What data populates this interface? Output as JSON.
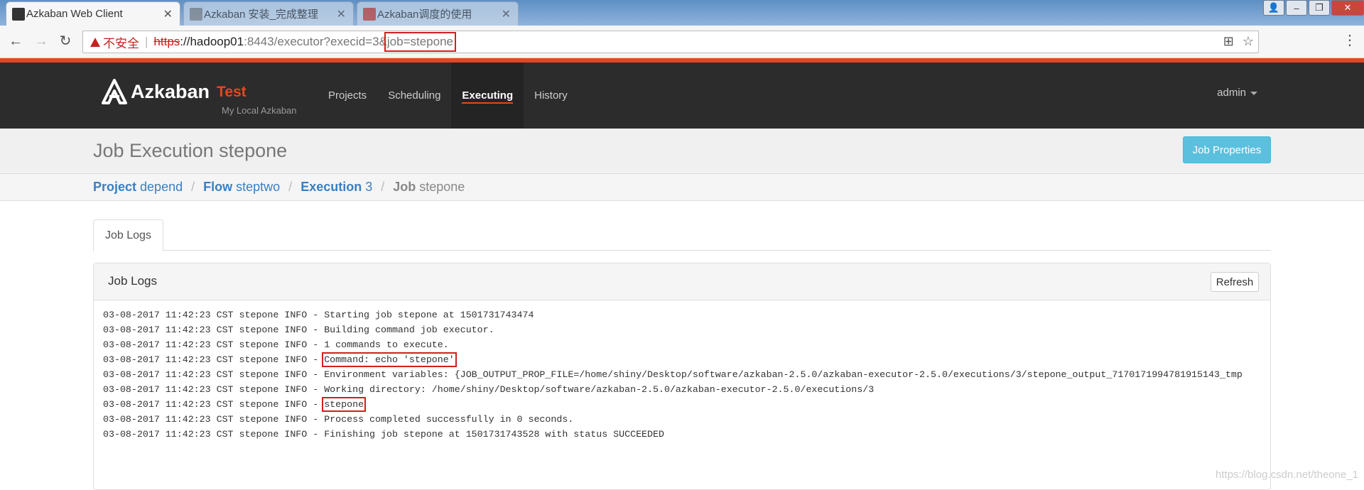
{
  "browser": {
    "tabs": [
      {
        "title": "Azkaban Web Client",
        "active": true
      },
      {
        "title": "Azkaban 安装_完成整理",
        "active": false
      },
      {
        "title": "Azkaban调度的使用",
        "active": false
      }
    ],
    "address": {
      "warning": "不安全",
      "scheme": "https",
      "host": "://hadoop01",
      "path": ":8443/executor?execid=3&",
      "highlight": "job=stepone"
    },
    "icons": [
      "back-icon",
      "forward-icon",
      "reload-icon",
      "translate-icon",
      "star-icon",
      "menu-icon"
    ]
  },
  "navbar": {
    "brand": "Azkaban",
    "env": "Test",
    "subtitle": "My Local Azkaban",
    "links": [
      "Projects",
      "Scheduling",
      "Executing",
      "History"
    ],
    "active_link": "Executing",
    "user": "admin"
  },
  "header": {
    "title": "Job Execution stepone",
    "job_properties_button": "Job Properties"
  },
  "breadcrumb": [
    {
      "key": "Project",
      "value": "depend"
    },
    {
      "key": "Flow",
      "value": "steptwo"
    },
    {
      "key": "Execution",
      "value": "3"
    },
    {
      "key": "Job",
      "value": "stepone"
    }
  ],
  "tabs": {
    "job_logs": "Job Logs"
  },
  "panel": {
    "title": "Job Logs",
    "refresh": "Refresh",
    "lines": [
      {
        "prefix": "03-08-2017 11:42:23 CST stepone INFO - ",
        "msg": "Starting job stepone at 1501731743474",
        "boxed": false
      },
      {
        "prefix": "03-08-2017 11:42:23 CST stepone INFO - ",
        "msg": "Building command job executor.",
        "boxed": false
      },
      {
        "prefix": "03-08-2017 11:42:23 CST stepone INFO - ",
        "msg": "1 commands to execute.",
        "boxed": false
      },
      {
        "prefix": "03-08-2017 11:42:23 CST stepone INFO - ",
        "msg": "Command: echo 'stepone'",
        "boxed": true
      },
      {
        "prefix": "03-08-2017 11:42:23 CST stepone INFO - ",
        "msg": "Environment variables: {JOB_OUTPUT_PROP_FILE=/home/shiny/Desktop/software/azkaban-2.5.0/azkaban-executor-2.5.0/executions/3/stepone_output_7170171994781915143_tmp",
        "boxed": false
      },
      {
        "prefix": "03-08-2017 11:42:23 CST stepone INFO - ",
        "msg": "Working directory: /home/shiny/Desktop/software/azkaban-2.5.0/azkaban-executor-2.5.0/executions/3",
        "boxed": false
      },
      {
        "prefix": "03-08-2017 11:42:23 CST stepone INFO - ",
        "msg": "stepone",
        "boxed": true
      },
      {
        "prefix": "03-08-2017 11:42:23 CST stepone INFO - ",
        "msg": "Process completed successfully in 0 seconds.",
        "boxed": false
      },
      {
        "prefix": "03-08-2017 11:42:23 CST stepone INFO - ",
        "msg": "Finishing job stepone at 1501731743528 with status SUCCEEDED",
        "boxed": false
      }
    ]
  },
  "watermark": "https://blog.csdn.net/theone_1"
}
